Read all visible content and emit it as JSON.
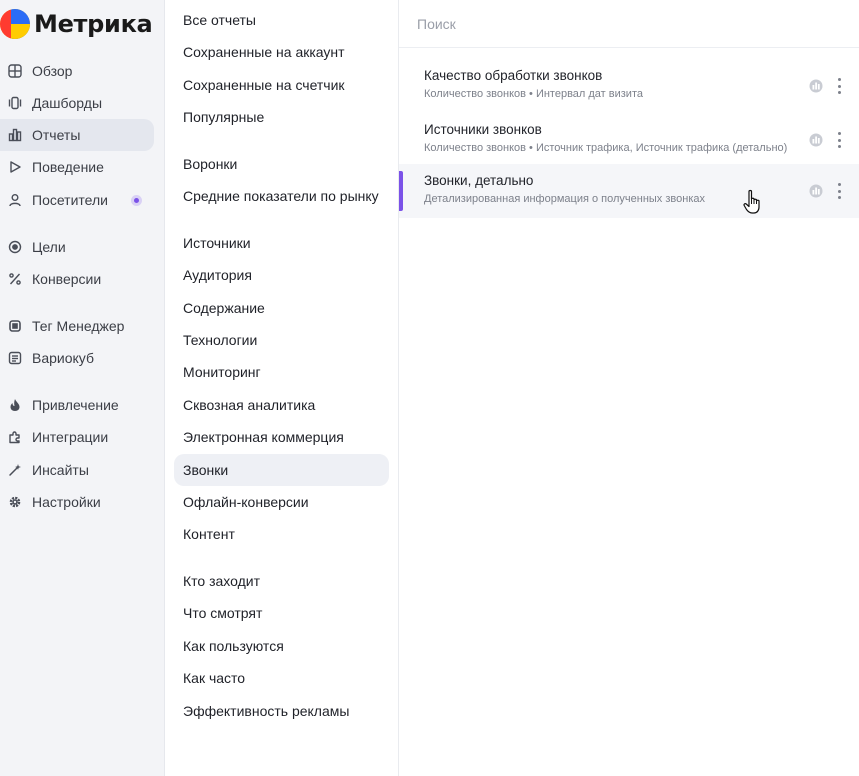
{
  "logo": {
    "text": "Метрика"
  },
  "sidebar": {
    "items": [
      {
        "label": "Обзор",
        "icon": "grid-icon"
      },
      {
        "label": "Дашборды",
        "icon": "dashboards-icon"
      },
      {
        "label": "Отчеты",
        "icon": "bar-chart-icon",
        "active": true
      },
      {
        "label": "Поведение",
        "icon": "play-icon"
      },
      {
        "label": "Посетители",
        "icon": "user-icon",
        "badge": true
      },
      {
        "label": "Цели",
        "icon": "target-icon"
      },
      {
        "label": "Конверсии",
        "icon": "percent-icon"
      },
      {
        "label": "Тег Менеджер",
        "icon": "tag-manager-icon"
      },
      {
        "label": "Вариокуб",
        "icon": "variocube-icon"
      },
      {
        "label": "Привлечение",
        "icon": "flame-icon"
      },
      {
        "label": "Интеграции",
        "icon": "puzzle-icon"
      },
      {
        "label": "Инсайты",
        "icon": "sparkle-icon"
      },
      {
        "label": "Настройки",
        "icon": "gear-icon"
      }
    ]
  },
  "categories": {
    "items": [
      {
        "label": "Все отчеты"
      },
      {
        "label": "Сохраненные на аккаунт"
      },
      {
        "label": "Сохраненные на счетчик"
      },
      {
        "label": "Популярные"
      },
      {
        "label": "Воронки"
      },
      {
        "label": "Средние показатели по рынку"
      },
      {
        "label": "Источники"
      },
      {
        "label": "Аудитория"
      },
      {
        "label": "Содержание"
      },
      {
        "label": "Технологии"
      },
      {
        "label": "Мониторинг"
      },
      {
        "label": "Сквозная аналитика"
      },
      {
        "label": "Электронная коммерция"
      },
      {
        "label": "Звонки",
        "active": true
      },
      {
        "label": "Офлайн-конверсии"
      },
      {
        "label": "Контент"
      },
      {
        "label": "Кто заходит"
      },
      {
        "label": "Что смотрят"
      },
      {
        "label": "Как пользуются"
      },
      {
        "label": "Как часто"
      },
      {
        "label": "Эффективность рекламы"
      }
    ]
  },
  "search": {
    "placeholder": "Поиск",
    "value": ""
  },
  "reports": [
    {
      "title": "Качество обработки звонков",
      "subtitle": "Количество звонков • Интервал дат визита"
    },
    {
      "title": "Источники звонков",
      "subtitle": "Количество звонков • Источник трафика, Источник трафика (детально)"
    },
    {
      "title": "Звонки, детально",
      "subtitle": "Детализированная информация о полученных звонках",
      "active": true
    }
  ],
  "colors": {
    "accent": "#7b52e8",
    "sidebar_bg": "#f3f4f7"
  }
}
